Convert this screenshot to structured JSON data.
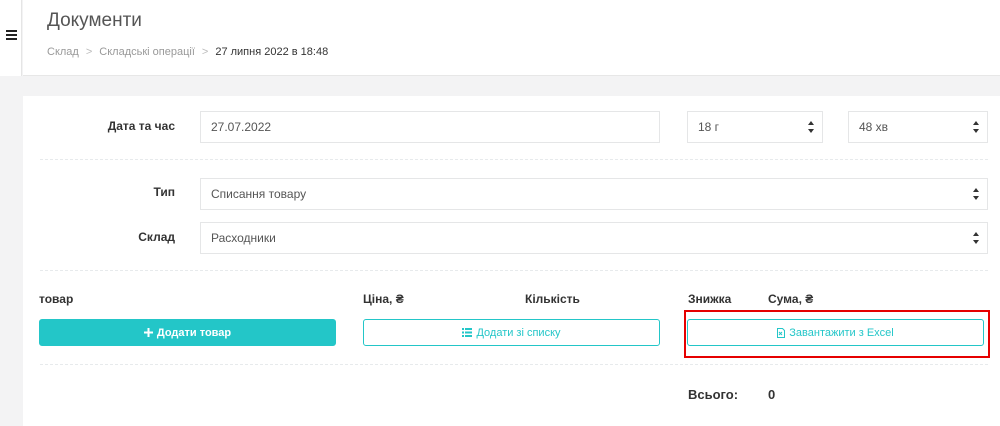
{
  "header": {
    "title": "Документи",
    "breadcrumb": [
      "Склад",
      "Складські операції",
      "27 липня 2022 в 18:48"
    ]
  },
  "form": {
    "datetime_label": "Дата та час",
    "date_value": "27.07.2022",
    "hour_value": "18 г",
    "minute_value": "48 хв",
    "type_label": "Тип",
    "type_value": "Списання товару",
    "warehouse_label": "Склад",
    "warehouse_value": "Расходники"
  },
  "table": {
    "columns": [
      "товар",
      "Ціна, ₴",
      "Кількість",
      "Знижка",
      "Сума, ₴"
    ]
  },
  "actions": {
    "add_product": "Додати товар",
    "add_from_list": "Додати зі списку",
    "upload_excel": "Завантажити з Excel"
  },
  "totals": {
    "label": "Всього:",
    "value": "0"
  },
  "colors": {
    "accent": "#23c6c8",
    "highlight": "#e60000"
  }
}
